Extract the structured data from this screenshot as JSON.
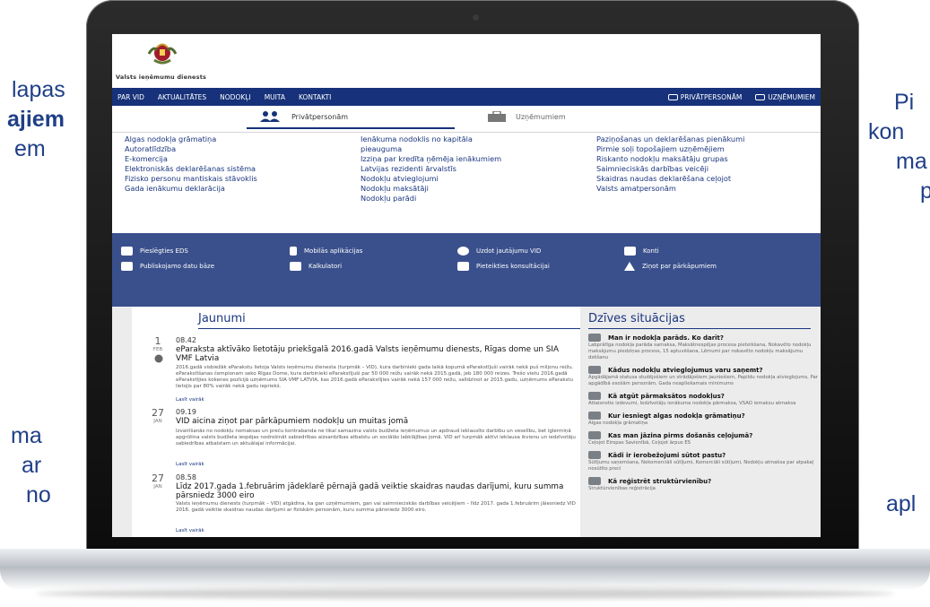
{
  "side_text": {
    "left_1": "lapas",
    "left_2": "ajiem",
    "left_3": "em",
    "left_4": "ma",
    "left_5": "ar",
    "left_6": "no",
    "right_1": "Pi",
    "right_2": "kon",
    "right_3": "ma",
    "right_4": "p",
    "right_5": "apl"
  },
  "site": {
    "agency_name": "Valsts ieņēmumu dienests",
    "topnav_left": [
      "PAR VID",
      "AKTUALITĀTES",
      "NODOKĻI",
      "MUITA",
      "KONTAKTI"
    ],
    "topnav_right": [
      "PRIVĀTPERSONĀM",
      "UZŅĒMUMIEM"
    ],
    "tab_active": "Privātpersonām",
    "tab_other": "Uzņēmumiem",
    "links": [
      [
        "Algas nodokļa grāmatiņa",
        "Autoratlīdzība",
        "E-komercija",
        "Elektroniskās deklarēšanas sistēma",
        "Fizisko personu mantiskais stāvoklis",
        "Gada ienākumu deklarācija"
      ],
      [
        "Ienākuma nodoklis no kapitāla",
        "pieauguma",
        "Izziņa par kredīta ņēmēja ienākumiem",
        "Latvijas rezidenti ārvalstīs",
        "Nodokļu atvieglojumi",
        "Nodokļu maksātāji",
        "Nodokļu parādi"
      ],
      [
        "Paziņošanas un deklarēšanas pienākumi",
        "Pirmie soļi topošajiem uzņēmējiem",
        "Riskanto nodokļu maksātāju grupas",
        "Saimnieciskās darbības veicēji",
        "Skaidras naudas deklarēšana ceļojot",
        "Valsts amatpersonām"
      ]
    ],
    "quick_links": [
      "Pieslēgties EDS",
      "Mobilās aplikācijas",
      "Uzdot jautājumu VID",
      "Konti",
      "Publiskojamo datu bāze",
      "Kalkulatori",
      "Pieteikties konsultācijai",
      "Ziņot par pārkāpumiem"
    ],
    "news_title": "Jaunumi",
    "life_title": "Dzīves situācijas",
    "news": [
      {
        "day": "1",
        "month": "FEB",
        "time": "08.42",
        "title": "eParaksta aktīvāko lietotāju priekšgalā 2016.gadā Valsts ieņēmumu dienests, Rīgas dome un SIA VMF Latvia",
        "body": "2016.gadā visbiežāk eParakstu lietoja Valsts ieņēmumu dienesta (turpmāk – VID), kura darbinieki gada laikā kopumā eParakstījuši vairāk nekā puš miljonu reižu. eParakstīšanas čempionam seko Rīgas Dome, kura darbinieki eParakstījuši par 50 000 reižu vairāk nekā 2015.gadā, jeb 180 000 reizes. Trešo vietu 2016.gadā eParakstījies kokenes pozīcijā uzņēmums SIA VMF LATVIA, kas 2016.gadā eParakstījies vairāk nekā 157 000 reižu, salīdzinot ar 2015.gadu, uzņēmums eParakstu lietojis par 80% vairāk nekā gadu iepriekš.",
        "more": "Lasīt vairāk"
      },
      {
        "day": "27",
        "month": "JAN",
        "time": "09.19",
        "title": "VID aicina ziņot par pārkāpumiem nodokļu un muitas jomā",
        "body": "Izvairīšanās no nodokļu nomaksas un preču kontrabanda ne tikai samazina valsts budžeta ieņēmumus un apdraud ieklausīto darbību un veselību, bet iglermiņā apgrūtina valsts budžeta iespējas nodrošināt sabiedrības aizsardzības atbalstu un sociālās labklājības jomā. VID arī turpmāk aktīvi ieklausa ikvienu un iedzīvotāju sabiedrības atbalstam un aktuālajai informācijai.",
        "more": "Lasīt vairāk"
      },
      {
        "day": "27",
        "month": "JAN",
        "time": "08.58",
        "title": "Līdz 2017.gada 1.februārim jādeklarē pērnajā gadā veiktie skaidras naudas darījumi, kuru summa pārsniedz 3000 eiro",
        "body": "Valsts ieņēmumu dienests (turpmāk – VID) atgādina, ka gan uzņēmumiem, gan vai saimnieciskās darbības veicējiem – līdz 2017. gada 1.februārim jāiesniedz VID 2016. gadā veiktie skaidras naudas darījumi ar fiziskām personām, kuru summa pārsniedz 3000 eiro.",
        "more": "Lasīt vairāk"
      }
    ],
    "life_items": [
      {
        "title": "Man ir nodokļa parāds. Ko darīt?",
        "desc": "Labprātīga nodokļa parāda samaksa, Maksātnespējas procesa pieteikšana, Nokavēto nodokļu maksājumu piedziņas process, 15 aptuvēšana, Lēmumi par nokavēto nodokļu maksājumu dzēšanu"
      },
      {
        "title": "Kādus nodokļu atvieglojumus varu saņemt?",
        "desc": "Apgādājamā statusa studējošiem un strādājošiem jauniešiem, Papildu nodokļa atvieglojums, Par apgādībā esošām personām, Gada neapliekamais minimums"
      },
      {
        "title": "Kā atgūt pārmaksātos nodokļus?",
        "desc": "Attaisnotie izdevumi, Iedzīvotāju ienākuma nodokļa pārmaksa, VSAO iemaksu atmaksa"
      },
      {
        "title": "Kur iesniegt algas nodokļa grāmatiņu?",
        "desc": "Algas nodokļa grāmatiņa"
      },
      {
        "title": "Kas man jāzina pirms došanās ceļojumā?",
        "desc": "Ceļojot Eiropas Savienībā, Ceļojot ārpus ES"
      },
      {
        "title": "Kādi ir ierobežojumi sūtot pastu?",
        "desc": "Sūtījumu saņemšana, Nekomerciāli sūtījumi, Komerciāli sūtījumi, Nodokļu atmaksa par atpakaļ nosūtīto preci"
      },
      {
        "title": "Kā reģistrēt struktūrvienību?",
        "desc": "Struktūrvienības reģistrācija"
      }
    ]
  }
}
